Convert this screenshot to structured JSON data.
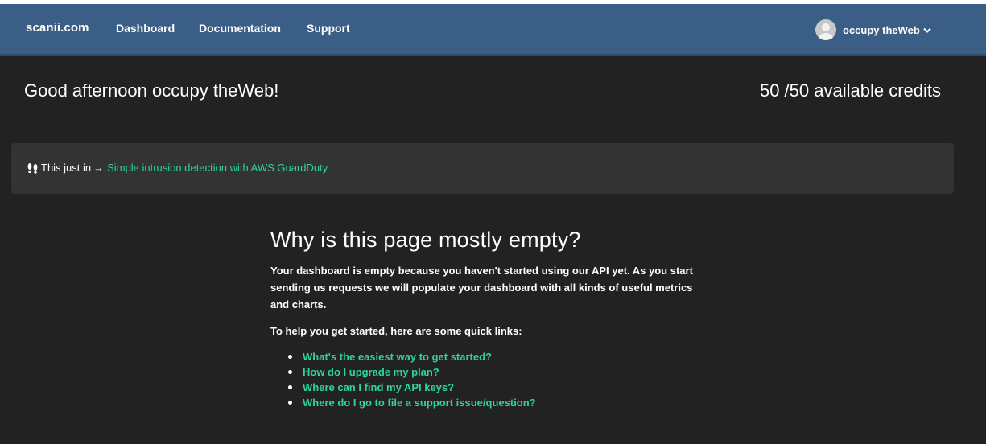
{
  "navbar": {
    "brand": "scanii.com",
    "links": [
      "Dashboard",
      "Documentation",
      "Support"
    ],
    "user_name": "occupy theWeb"
  },
  "header": {
    "greeting": "Good afternoon occupy theWeb!",
    "credits": "50 /50 available credits"
  },
  "alert": {
    "prefix": "This just in",
    "arrow": "→",
    "link_text": "Simple intrusion detection with AWS GuardDuty",
    "icon": "footprints-icon"
  },
  "empty_state": {
    "title": "Why is this page mostly empty?",
    "description": "Your dashboard is empty because you haven't started using our API yet. As you start sending us requests we will populate your dashboard with all kinds of useful metrics and charts.",
    "links_intro": "To help you get started, here are some quick links:",
    "links": [
      "What's the easiest way to get started?",
      "How do I upgrade my plan?",
      "Where can I find my API keys?",
      "Where do I go to file a support issue/question?"
    ]
  },
  "colors": {
    "navbar": "#3b5e86",
    "background": "#222222",
    "alert_bg": "#333333",
    "link": "#2fd39b"
  }
}
